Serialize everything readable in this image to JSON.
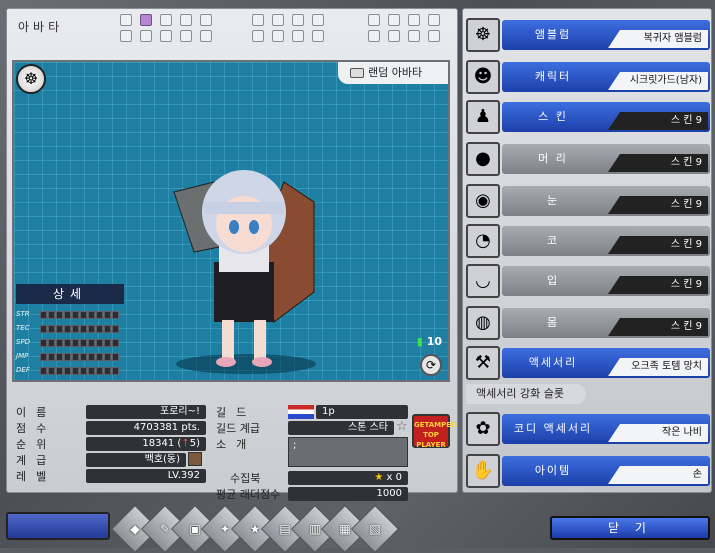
{
  "header": {
    "title": "아바타"
  },
  "slots": {
    "active_index": 2
  },
  "view": {
    "random_label": "랜덤 아바타",
    "signal_value": "10"
  },
  "detail": {
    "title": "상세",
    "stats": [
      "STR",
      "TEC",
      "SPD",
      "JMP",
      "DEF"
    ]
  },
  "profile": {
    "labels": {
      "name": "이름",
      "score": "점수",
      "rank": "순위",
      "class": "계급",
      "level": "레벨",
      "guild": "길드",
      "guild_rank": "길드 계급",
      "intro": "소개",
      "collection": "수집북",
      "ladder": "평균 래더점수"
    },
    "name": "포로리~!",
    "score": "4703381 pts.",
    "rank": "18341 (",
    "rank_change": "5",
    "rank_close": ")",
    "class": "백호(동)",
    "level": "LV.392",
    "guild": "1p",
    "guild_rank": "스톤 스타",
    "intro": ";",
    "collection": "x 0",
    "ladder": "1000",
    "top_player": "GETAMPED\nTOP\nPLAYER\nRANKER"
  },
  "right": {
    "items": [
      {
        "name": "앰블럼",
        "value": "복귀자 앰블럼",
        "style": "blue",
        "icon": "emblem-icon"
      },
      {
        "name": "캐릭터",
        "value": "시크릿가드(남자)",
        "style": "blue",
        "icon": "character-icon"
      },
      {
        "name": "스 킨",
        "value": "스 킨 9",
        "style": "blue",
        "icon": "skin-icon"
      },
      {
        "name": "머 리",
        "value": "스 킨 9",
        "style": "gray",
        "icon": "hair-icon"
      },
      {
        "name": "눈",
        "value": "스 킨 9",
        "style": "gray",
        "icon": "eye-icon"
      },
      {
        "name": "코",
        "value": "스 킨 9",
        "style": "gray",
        "icon": "nose-icon"
      },
      {
        "name": "입",
        "value": "스 킨 9",
        "style": "gray",
        "icon": "mouth-icon"
      },
      {
        "name": "몸",
        "value": "스 킨 9",
        "style": "gray",
        "icon": "body-icon"
      },
      {
        "name": "액세서리",
        "value": "오크족 토템 망치",
        "style": "blue",
        "icon": "hammer-icon"
      },
      {
        "name": "코디 액세서리",
        "value": "작은 나비",
        "style": "blue",
        "icon": "butterfly-icon"
      },
      {
        "name": "아이템",
        "value": "손",
        "style": "blue",
        "icon": "hand-icon"
      }
    ],
    "sub_label": "액세서리 강화 슬롯"
  },
  "bottom": {
    "close": "닫 기"
  }
}
